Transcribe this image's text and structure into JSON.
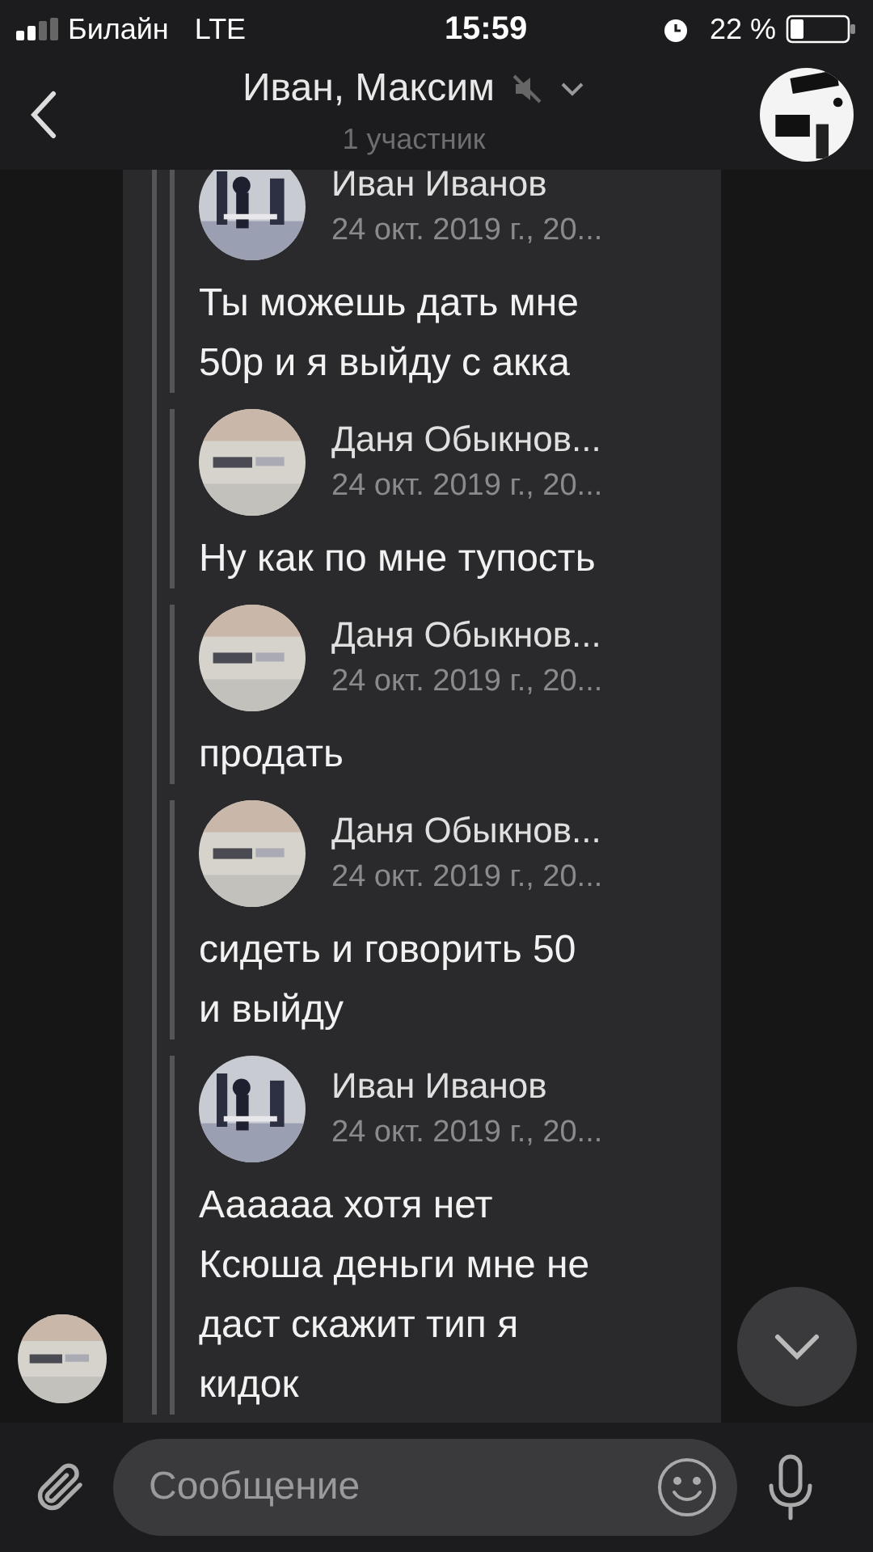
{
  "status_bar": {
    "carrier": "Билайн",
    "network": "LTE",
    "time": "15:59",
    "battery": "22 %"
  },
  "header": {
    "title": "Иван, Максим",
    "muted": true,
    "subtitle": "1 участник"
  },
  "forwarded": [
    {
      "author": "Иван Иванов",
      "date": "24 окт. 2019 г., 20...",
      "text": "Ты можешь дать мне\n50р и я выйду с акка"
    },
    {
      "author": "Даня Обыкнов...",
      "date": "24 окт. 2019 г., 20...",
      "text": "Ну как по мне тупость"
    },
    {
      "author": "Даня Обыкнов...",
      "date": "24 окт. 2019 г., 20...",
      "text": "продать"
    },
    {
      "author": "Даня Обыкнов...",
      "date": "24 окт. 2019 г., 20...",
      "text": "сидеть и говорить 50\nи выйду"
    },
    {
      "author": "Иван Иванов",
      "date": "24 окт. 2019 г., 20...",
      "text": "Аааааа хотя нет\nКсюша деньги мне не\nдаст скажит тип я\nкидок"
    }
  ],
  "composer": {
    "placeholder": "Сообщение"
  }
}
